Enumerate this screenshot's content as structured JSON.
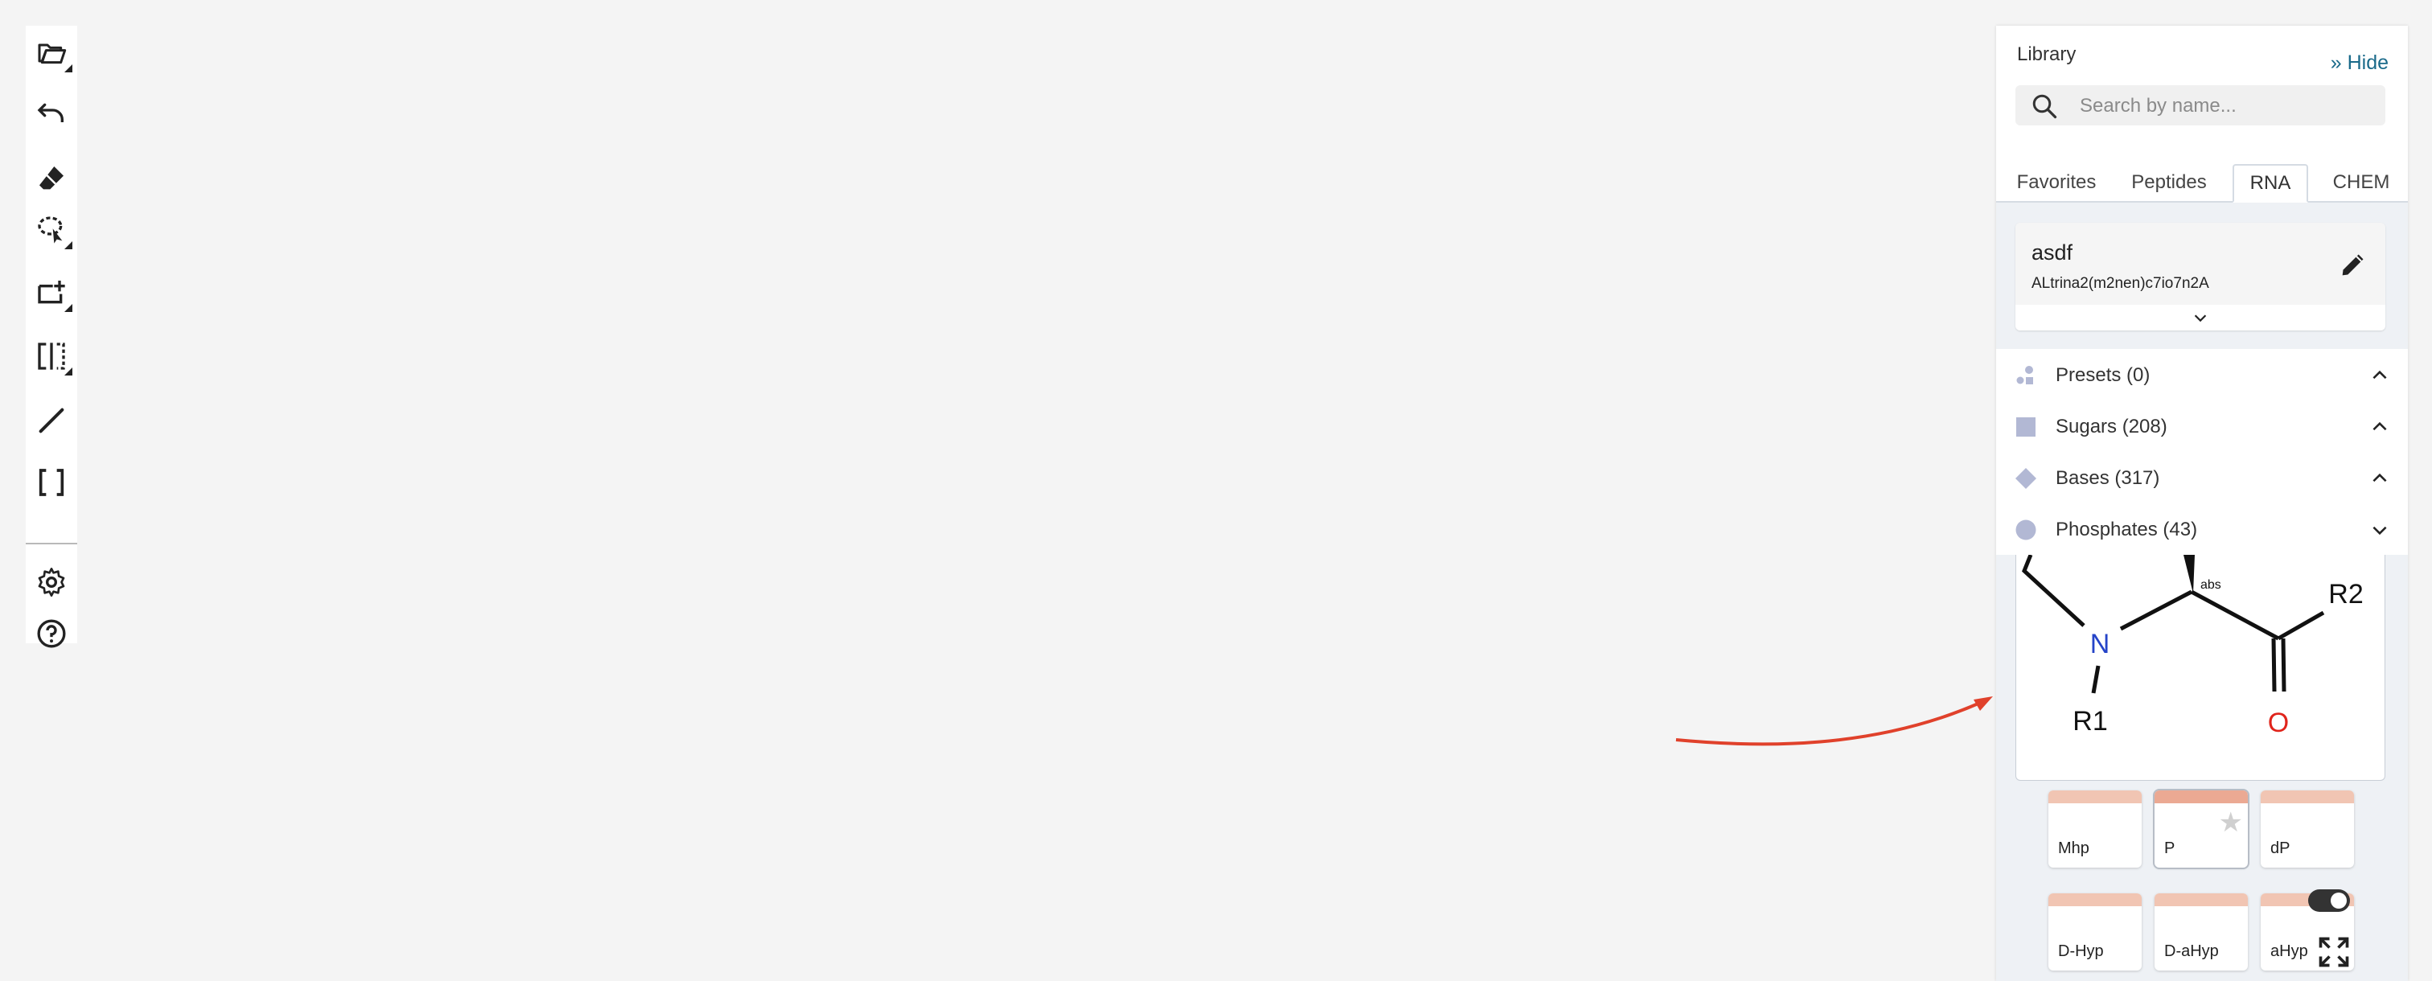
{
  "toolbar": {
    "tools": [
      {
        "icon": "open-file-icon"
      },
      {
        "icon": "undo-icon"
      },
      {
        "icon": "eraser-icon"
      },
      {
        "icon": "lasso-select-icon"
      },
      {
        "icon": "add-rectangle-icon"
      },
      {
        "icon": "flip-icon"
      },
      {
        "icon": "single-bond-icon"
      },
      {
        "icon": "brackets-icon"
      },
      {
        "icon": "settings-icon"
      },
      {
        "icon": "help-icon"
      }
    ]
  },
  "library": {
    "title": "Library",
    "hide_label": "» Hide",
    "search": {
      "placeholder": "Search by name...",
      "value": ""
    },
    "tabs": [
      {
        "label": "Favorites",
        "active": false
      },
      {
        "label": "Peptides",
        "active": false
      },
      {
        "label": "RNA",
        "active": true
      },
      {
        "label": "CHEM",
        "active": false
      }
    ],
    "preset": {
      "name": "asdf",
      "sequence": "ALtrina2(m2nen)c7io7n2A"
    },
    "groups": [
      {
        "label": "Presets (0)",
        "icon": "presets-icon",
        "state": "expanded"
      },
      {
        "label": "Sugars (208)",
        "icon": "sugar-square-icon",
        "state": "expanded"
      },
      {
        "label": "Bases (317)",
        "icon": "base-diamond-icon",
        "state": "expanded"
      },
      {
        "label": "Phosphates (43)",
        "icon": "phosphate-circle-icon",
        "state": "collapsed"
      }
    ],
    "structure": {
      "atoms": {
        "n": "N",
        "o": "O",
        "r1": "R1",
        "r2": "R2",
        "stereo": "abs"
      }
    },
    "monomers": [
      {
        "label": "Mhp",
        "selected": false
      },
      {
        "label": "P",
        "selected": true,
        "favorite_icon": "star-icon"
      },
      {
        "label": "dP",
        "selected": false
      },
      {
        "label": "D-Hyp",
        "selected": false
      },
      {
        "label": "D-aHyp",
        "selected": false
      },
      {
        "label": "aHyp",
        "selected": false
      }
    ],
    "toggle_on": true
  },
  "colors": {
    "accent": "#1a6a8a",
    "monomer_header": "#f1c5b3",
    "monomer_header_selected": "#eba993",
    "nitrogen": "#2544c8",
    "oxygen": "#e0241b",
    "arrow": "#e0412b",
    "group_icon": "#b2b8d4"
  }
}
